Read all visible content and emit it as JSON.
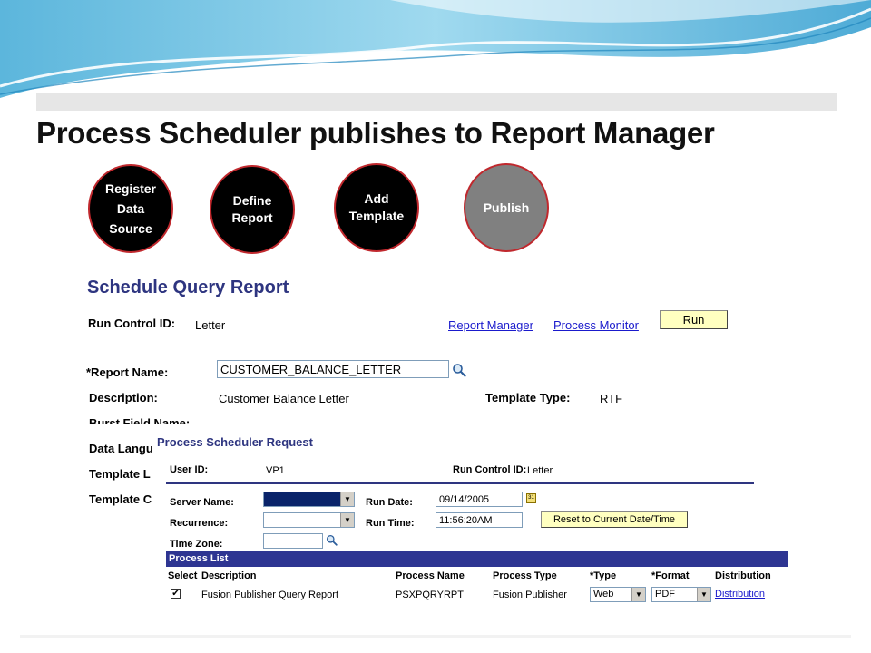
{
  "slide": {
    "title": "Process Scheduler publishes to Report Manager",
    "steps": [
      {
        "label": "Register\nData\nSource"
      },
      {
        "label": "Define\nReport"
      },
      {
        "label": "Add\nTemplate"
      },
      {
        "label": "Publish"
      }
    ]
  },
  "page": {
    "title": "Schedule Query Report",
    "run_control_label": "Run Control ID:",
    "run_control_value": "Letter",
    "report_manager_link": "Report Manager",
    "process_monitor_link": "Process Monitor",
    "run_button": "Run",
    "report_name_label": "*Report Name:",
    "report_name_value": "CUSTOMER_BALANCE_LETTER",
    "description_label": "Description:",
    "description_value": "Customer Balance Letter",
    "template_type_label": "Template Type:",
    "template_type_value": "RTF",
    "burst_label": "Burst Field Name:",
    "data_lang_label": "Data Langu",
    "template_l_label": "Template L",
    "template_c_label": "Template C"
  },
  "popup": {
    "title": "Process Scheduler Request",
    "user_id_label": "User ID:",
    "user_id_value": "VP1",
    "run_control_label": "Run Control ID:",
    "run_control_value": "Letter",
    "server_name_label": "Server Name:",
    "server_name_value": "",
    "recurrence_label": "Recurrence:",
    "recurrence_value": "",
    "time_zone_label": "Time Zone:",
    "time_zone_value": "",
    "run_date_label": "Run Date:",
    "run_date_value": "09/14/2005",
    "run_time_label": "Run Time:",
    "run_time_value": "11:56:20AM",
    "reset_button": "Reset to Current Date/Time",
    "calendar_icon_text": "31",
    "process_list": {
      "header": "Process List",
      "columns": {
        "select": "Select",
        "description": "Description",
        "process_name": "Process Name",
        "process_type": "Process Type",
        "type": "*Type",
        "format": "*Format",
        "distribution": "Distribution"
      },
      "rows": [
        {
          "checked": "✔",
          "description": "Fusion Publisher Query Report",
          "process_name": "PSXPQRYRPT",
          "process_type": "Fusion Publisher",
          "type": "Web",
          "format": "PDF",
          "distribution": "Distribution"
        }
      ]
    }
  },
  "colors": {
    "heading_blue": "#2e3580",
    "list_header_bg": "#2e3592",
    "button_yellow": "#ffffc0",
    "step_border": "#c0282d",
    "step_publish": "#808080"
  }
}
